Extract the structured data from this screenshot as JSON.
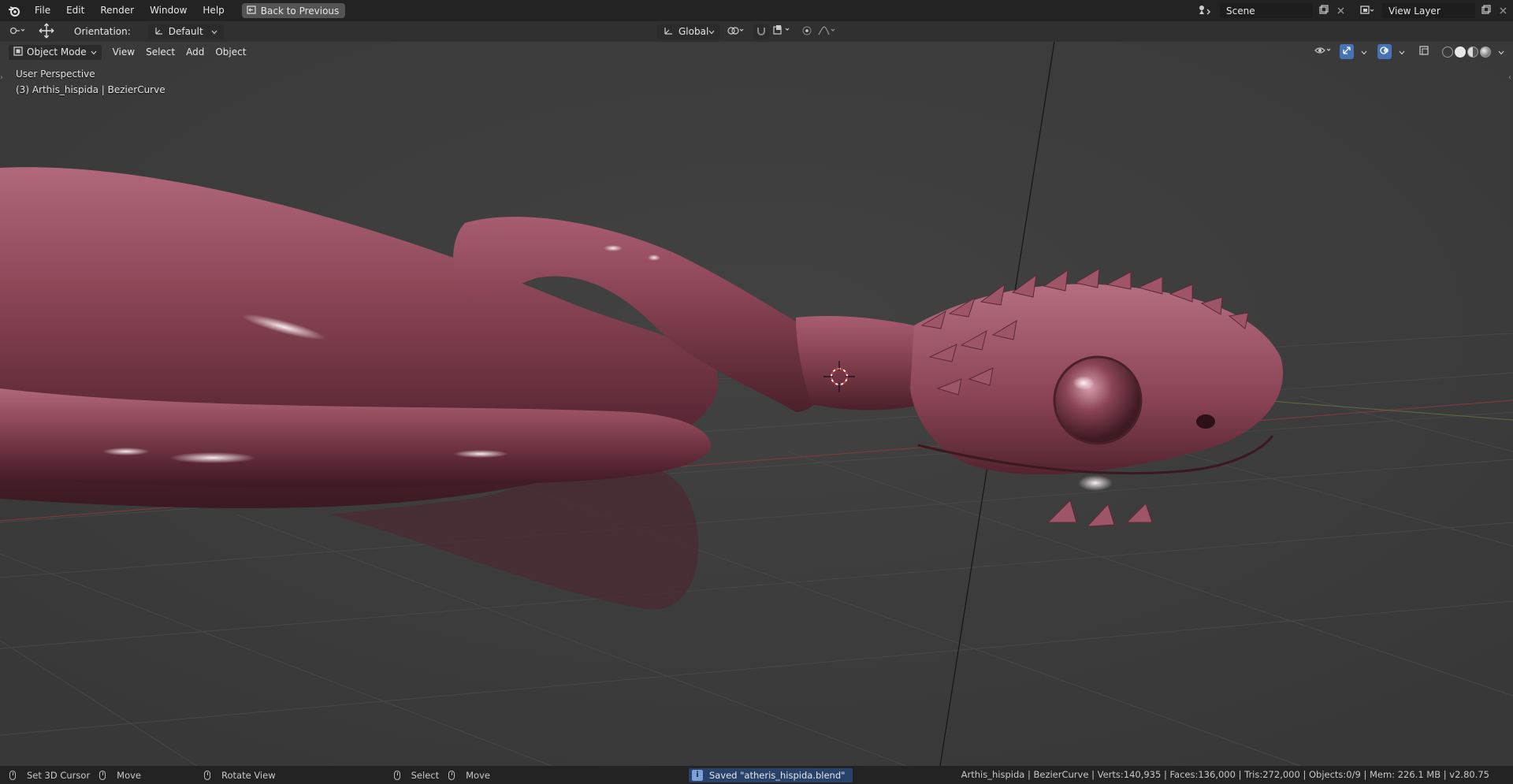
{
  "menu": {
    "items": [
      "File",
      "Edit",
      "Render",
      "Window",
      "Help"
    ],
    "back_button": "Back to Previous"
  },
  "scene": {
    "value": "Scene"
  },
  "view_layer": {
    "value": "View Layer"
  },
  "toolbar": {
    "orientation_label": "Orientation:",
    "orientation_value": "Default",
    "transform_space": "Global"
  },
  "viewport_header": {
    "mode": "Object Mode",
    "menus": [
      "View",
      "Select",
      "Add",
      "Object"
    ]
  },
  "viewport": {
    "perspective": "User Perspective",
    "object_info": "(3) Arthis_hispida | BezierCurve"
  },
  "statusbar": {
    "set_cursor": "Set 3D Cursor",
    "move1": "Move",
    "rotate": "Rotate View",
    "select": "Select",
    "move2": "Move",
    "saved_msg": "Saved \"atheris_hispida.blend\"",
    "stats": "Arthis_hispida | BezierCurve | Verts:140,935 | Faces:136,000 | Tris:272,000 | Objects:0/9 | Mem: 226.1 MB | v2.80.75"
  },
  "colors": {
    "snake": "#8a4455",
    "topbar": "#232323",
    "viewport_bg": "#3d3d3d",
    "accent": "#27436b"
  }
}
